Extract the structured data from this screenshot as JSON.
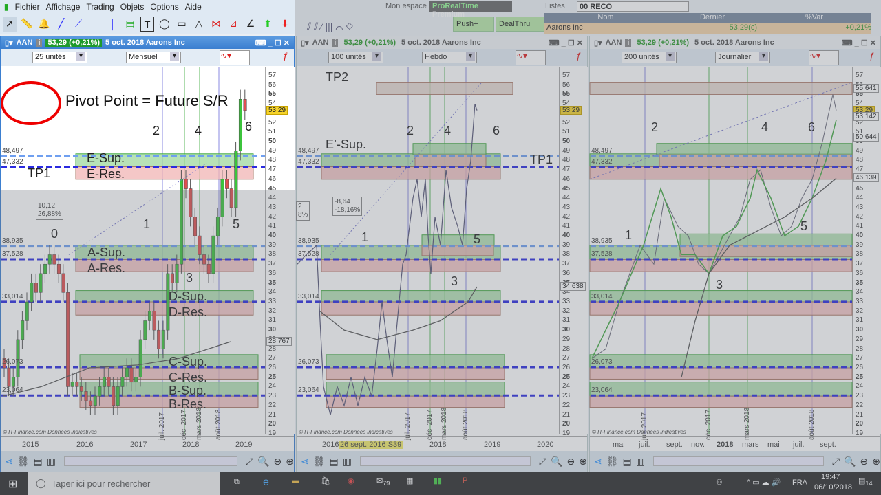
{
  "menu": [
    "Fichier",
    "Affichage",
    "Trading",
    "Objets",
    "Options",
    "Aide"
  ],
  "top": {
    "mon_espace": "Mon espace",
    "brand": "ProRealTime",
    "brand2": "Premium",
    "push": "Push+",
    "dealthru": "DealThru"
  },
  "lists": {
    "label": "Listes",
    "selected": "00 RECO",
    "columns": [
      "Nom",
      "Dernier",
      "%Var"
    ],
    "rows": [
      {
        "name": "Aarons Inc",
        "last": "53,29(c)",
        "var": "+0,21%"
      }
    ]
  },
  "charts": [
    {
      "symbol": "AAN",
      "price": "53,29 (+0,21%)",
      "date": "5 oct. 2018 Aarons Inc",
      "units": "25 unités",
      "period": "Mensuel",
      "years": [
        "2015",
        "2016",
        "2017",
        "2018",
        "2019"
      ],
      "vdates": [
        "juil. 2017",
        "déc. 2017",
        "mars 2018",
        "août 2018"
      ],
      "tags": [
        {
          "v": "53,29",
          "p": 53.29,
          "y": true
        },
        {
          "v": "28,767",
          "p": 28.77
        }
      ],
      "annot": {
        "pivot": "Pivot Point = Future S/R",
        "tp1": "TP1",
        "waves": [
          "0",
          "1",
          "2",
          "3",
          "4",
          "5",
          "6"
        ],
        "zones": [
          "E-Sup.",
          "E-Res.",
          "A-Sup.",
          "A-Res.",
          "D-Sup.",
          "D-Res.",
          "C-Sup.",
          "C-Res.",
          "B-Sup.",
          "B-Res."
        ],
        "box1": "10,12",
        "box2": "26,88%"
      }
    },
    {
      "symbol": "AAN",
      "price": "53,29 (+0,21%)",
      "date": "5 oct. 2018 Aarons Inc",
      "units": "100 unités",
      "period": "Hebdo",
      "years": [
        "2016",
        "2018",
        "2019",
        "2020"
      ],
      "cursor_date": "26 sept. 2016 S39",
      "vdates": [
        "juil. 2017",
        "déc. 2017",
        "mars 2018",
        "août 2018"
      ],
      "tags": [
        {
          "v": "53,29",
          "p": 53.29,
          "y": true
        },
        {
          "v": "34,638",
          "p": 34.64
        }
      ],
      "annot": {
        "tp2": "TP2",
        "esup": "E’-Sup.",
        "tp1": "TP1",
        "waves": [
          "1",
          "2",
          "3",
          "4",
          "5",
          "6"
        ],
        "box1": "-8,64",
        "box2": "-18,16%",
        "box3": "2",
        "box4": "8%"
      }
    },
    {
      "symbol": "AAN",
      "price": "53,29 (+0,21%)",
      "date": "5 oct. 2018 Aarons Inc",
      "units": "200 unités",
      "period": "Journalier",
      "years": [
        "mai",
        "juil.",
        "sept.",
        "nov.",
        "2018",
        "mars",
        "mai",
        "juil.",
        "sept."
      ],
      "vdates": [
        "juil. 2017",
        "déc. 2017",
        "mars 2018",
        "août 2018"
      ],
      "tags": [
        {
          "v": "55,641",
          "p": 55.64
        },
        {
          "v": "53,29",
          "p": 53.29,
          "y": true
        },
        {
          "v": "53,142",
          "p": 52.6
        },
        {
          "v": "50,644",
          "p": 50.4
        },
        {
          "v": "46,139",
          "p": 46.14
        }
      ],
      "annot": {
        "waves": [
          "1",
          "2",
          "3",
          "4",
          "5",
          "6"
        ]
      }
    }
  ],
  "levels": [
    "48,497",
    "47,332",
    "38,935",
    "37,528",
    "33,014",
    "26,073",
    "23,064"
  ],
  "level_values": [
    48.497,
    47.332,
    38.935,
    37.528,
    33.014,
    26.073,
    23.064
  ],
  "copyright": "© IT-Finance.com",
  "copyright2": "Données indicatives",
  "taskbar": {
    "search": "Taper ici pour rechercher",
    "lang": "FRA",
    "time": "19:47",
    "date": "06/10/2018",
    "mail_count": "79",
    "notif": "14"
  },
  "colors": {
    "up": "#3cc43c",
    "down": "#e05050",
    "support": "#9fd89f",
    "resistance": "#f0b4b4",
    "level_dark": "#2a2ae0",
    "level_light": "#6f9ff0"
  }
}
